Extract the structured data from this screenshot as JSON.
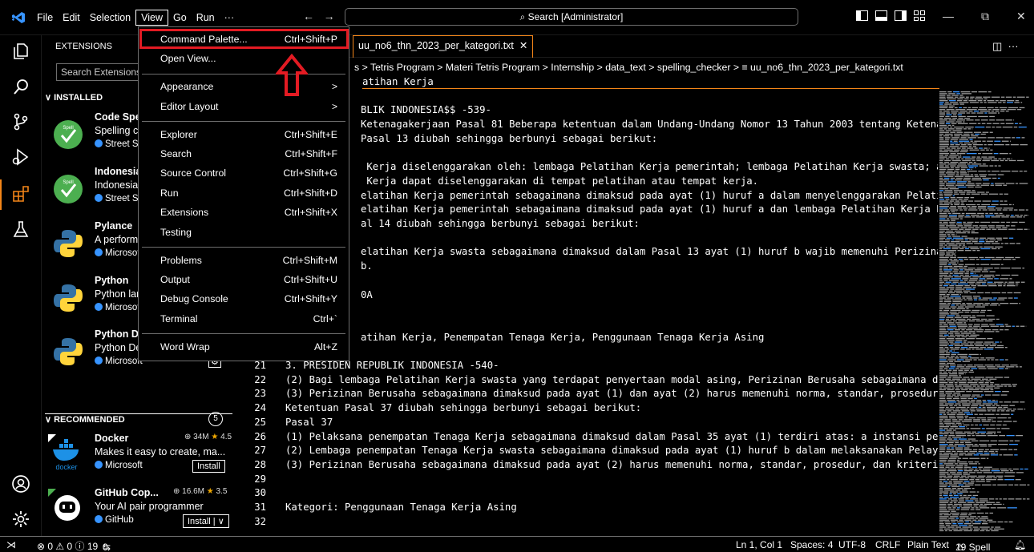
{
  "menubar": {
    "items": [
      "File",
      "Edit",
      "Selection",
      "View",
      "Go",
      "Run",
      "···"
    ]
  },
  "search": {
    "label": "Search [Administrator]"
  },
  "sidebar": {
    "title": "EXTENSIONS",
    "search_placeholder": "Search Extensions in Marketplace",
    "installed_label": "INSTALLED",
    "recommended_label": "RECOMMENDED",
    "recommended_count": "5",
    "installed": [
      {
        "name": "Code Spell Checker",
        "desc": "Spelling checker for source code",
        "publisher": "Street Side Software",
        "icon": "spell-icon"
      },
      {
        "name": "Indonesian - Code Spell Checker",
        "desc": "Indonesian dictionary",
        "publisher": "Street Side Software",
        "icon": "spell-icon"
      },
      {
        "name": "Pylance",
        "desc": "A performant Python language server",
        "publisher": "Microsoft",
        "icon": "python-icon"
      },
      {
        "name": "Python",
        "desc": "Python language support",
        "publisher": "Microsoft",
        "icon": "python-icon"
      },
      {
        "name": "Python Debugger",
        "desc": "Python Debugger extension",
        "publisher": "Microsoft",
        "icon": "python-icon"
      }
    ],
    "recommended": [
      {
        "name": "Docker",
        "downloads": "34M",
        "rating": "4.5",
        "desc": "Makes it easy to create, ma...",
        "publisher": "Microsoft",
        "button": "Install"
      },
      {
        "name": "GitHub Cop...",
        "downloads": "16.6M",
        "rating": "3.5",
        "desc": "Your AI pair programmer",
        "publisher": "GitHub",
        "button": "Install"
      }
    ]
  },
  "editor": {
    "tab_label": "uu_no6_thn_2023_per_kategori.txt",
    "breadcrumb": "s > Tetris Program > Materi Tetris Program > Internship > data_text > spelling_checker > ≡ uu_no6_thn_2023_per_kategori.txt",
    "lines": [
      {
        "n": "",
        "t": "atihan Kerja"
      },
      {
        "n": "",
        "t": ""
      },
      {
        "n": "",
        "t": "BLIK INDONESIA$$ -539-"
      },
      {
        "n": "",
        "t": "Ketenagakerjaan Pasal 81 Beberapa ketentuan dalam Undang-Undang Nomor 13 Tahun 2003 tentang Ketenag"
      },
      {
        "n": "",
        "t": "Pasal 13 diubah sehingga berbunyi sebagai berikut:"
      },
      {
        "n": "",
        "t": ""
      },
      {
        "n": "",
        "t": " Kerja diselenggarakan oleh: lembaga Pelatihan Kerja pemerintah; lembaga Pelatihan Kerja swasta; at"
      },
      {
        "n": "",
        "t": " Kerja dapat diselenggarakan di tempat pelatihan atau tempat kerja."
      },
      {
        "n": "",
        "t": "elatihan Kerja pemerintah sebagaimana dimaksud pada ayat (1) huruf a dalam menyelenggarakan Pelatih"
      },
      {
        "n": "",
        "t": "elatihan Kerja pemerintah sebagaimana dimaksud pada ayat (1) huruf a dan lembaga Pelatihan Kerja Pe"
      },
      {
        "n": "",
        "t": "al 14 diubah sehingga berbunyi sebagai berikut:"
      },
      {
        "n": "",
        "t": ""
      },
      {
        "n": "",
        "t": "elatihan Kerja swasta sebagaimana dimaksud dalam Pasal 13 ayat (1) huruf b wajib memenuhi Perizinar"
      },
      {
        "n": "",
        "t": "b."
      },
      {
        "n": "",
        "t": ""
      },
      {
        "n": "",
        "t": "0A"
      },
      {
        "n": "",
        "t": ""
      },
      {
        "n": "",
        "t": ""
      },
      {
        "n": "",
        "t": "atihan Kerja, Penempatan Tenaga Kerja, Penggunaan Tenaga Kerja Asing"
      },
      {
        "n": "",
        "t": ""
      },
      {
        "n": "21",
        "t": "3. PRESIDEN REPUBLIK INDONESIA -540-"
      },
      {
        "n": "22",
        "t": "(2) Bagi lembaga Pelatihan Kerja swasta yang terdapat penyertaan modal asing, Perizinan Berusaha sebagaimana dim"
      },
      {
        "n": "23",
        "t": "(3) Perizinan Berusaha sebagaimana dimaksud pada ayat (1) dan ayat (2) harus memenuhi norma, standar, prosedur,"
      },
      {
        "n": "24",
        "t": "Ketentuan Pasal 37 diubah sehingga berbunyi sebagai berikut:"
      },
      {
        "n": "25",
        "t": "Pasal 37"
      },
      {
        "n": "26",
        "t": "(1) Pelaksana penempatan Tenaga Kerja sebagaimana dimaksud dalam Pasal 35 ayat (1) terdiri atas: a instansi peme"
      },
      {
        "n": "27",
        "t": "(2) Lembaga penempatan Tenaga Kerja swasta sebagaimana dimaksud pada ayat (1) huruf b dalam melaksanakan Pelayar"
      },
      {
        "n": "28",
        "t": "(3) Perizinan Berusaha sebagaimana dimaksud pada ayat (2) harus memenuhi norma, standar, prosedur, dan kriteria"
      },
      {
        "n": "29",
        "t": ""
      },
      {
        "n": "30",
        "t": ""
      },
      {
        "n": "31",
        "t": "Kategori: Penggunaan Tenaga Kerja Asing"
      },
      {
        "n": "32",
        "t": ""
      }
    ]
  },
  "view_menu": [
    {
      "label": "Command Palette...",
      "key": "Ctrl+Shift+P"
    },
    {
      "label": "Open View...",
      "key": ""
    },
    {
      "label": "Appearance",
      "key": ">"
    },
    {
      "label": "Editor Layout",
      "key": ">"
    },
    {
      "label": "Explorer",
      "key": "Ctrl+Shift+E"
    },
    {
      "label": "Search",
      "key": "Ctrl+Shift+F"
    },
    {
      "label": "Source Control",
      "key": "Ctrl+Shift+G"
    },
    {
      "label": "Run",
      "key": "Ctrl+Shift+D"
    },
    {
      "label": "Extensions",
      "key": "Ctrl+Shift+X"
    },
    {
      "label": "Testing",
      "key": ""
    },
    {
      "label": "Problems",
      "key": "Ctrl+Shift+M"
    },
    {
      "label": "Output",
      "key": "Ctrl+Shift+U"
    },
    {
      "label": "Debug Console",
      "key": "Ctrl+Shift+Y"
    },
    {
      "label": "Terminal",
      "key": "Ctrl+`"
    },
    {
      "label": "Word Wrap",
      "key": "Alt+Z"
    }
  ],
  "statusbar": {
    "problems": "⊗ 0 ⚠ 0 ⓘ 19",
    "ports": "0",
    "position": "Ln 1, Col 1",
    "spaces": "Spaces: 4",
    "encoding": "UTF-8",
    "eol": "CRLF",
    "language": "Plain Text",
    "spell": "19 Spell"
  },
  "colors": {
    "background": "#000000",
    "border": "#6e6e6e",
    "highlight": "#e31b23",
    "focus": "#f38518",
    "rating": "#f0a800"
  }
}
